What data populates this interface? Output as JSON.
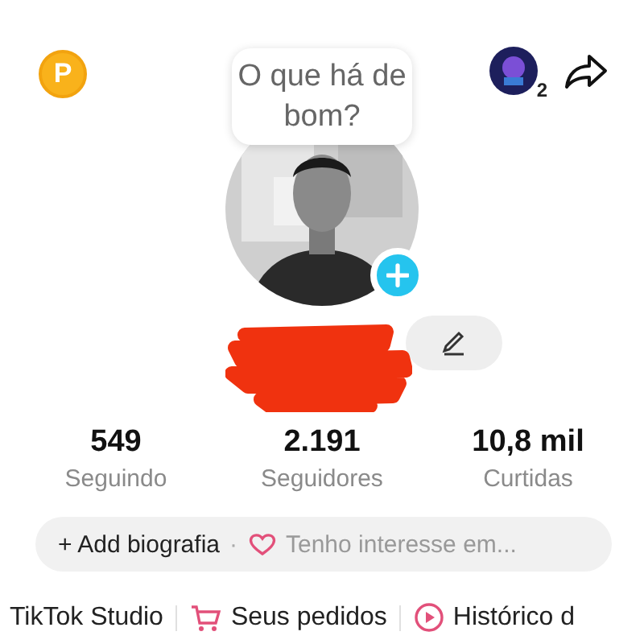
{
  "header": {
    "coin_letter": "P",
    "speech_bubble": "O que há de bom?",
    "notification_count": "2"
  },
  "stats": [
    {
      "value": "549",
      "label": "Seguindo"
    },
    {
      "value": "2.191",
      "label": "Seguidores"
    },
    {
      "value": "10,8 mil",
      "label": "Curtidas"
    }
  ],
  "bio": {
    "add_label": "+ Add biografia",
    "separator": "·",
    "interest": "Tenho interesse em..."
  },
  "shortcuts": [
    {
      "kind": "plain",
      "label": "TikTok Studio"
    },
    {
      "kind": "cart",
      "label": "Seus pedidos"
    },
    {
      "kind": "play",
      "label": "Histórico d"
    }
  ]
}
